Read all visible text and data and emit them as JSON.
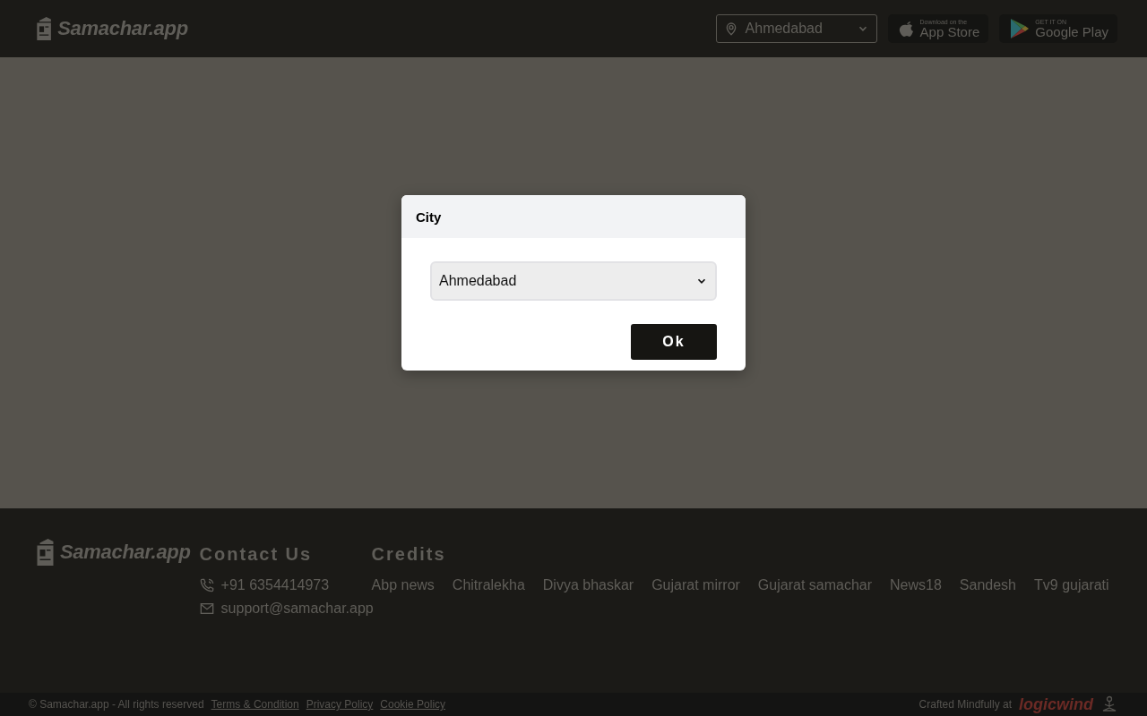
{
  "header": {
    "logo": "Samachar.app",
    "city_select": {
      "value": "Ahmedabad"
    },
    "store_badges": [
      {
        "kind": "apple",
        "small": "Download on the",
        "large": "App Store"
      },
      {
        "kind": "google",
        "small": "GET IT ON",
        "large": "Google Play"
      }
    ]
  },
  "dialog": {
    "title": "City",
    "select": {
      "value": "Ahmedabad"
    },
    "button": "Ok"
  },
  "footer": {
    "logo": "Samachar.app",
    "contact": {
      "heading": "Contact Us",
      "items": [
        {
          "kind": "phone",
          "text": "+91 6354414973"
        },
        {
          "kind": "email",
          "text": "support@samachar.app"
        }
      ]
    },
    "credits": {
      "heading": "Credits",
      "items": [
        "Abp news",
        "Chitralekha",
        "Divya bhaskar",
        "Gujarat mirror",
        "Gujarat samachar",
        "News18",
        "Sandesh",
        "Tv9 gujarati"
      ]
    }
  },
  "bottom_bar": {
    "copyright": "© Samachar.app - All rights reserved",
    "links": [
      "Terms & Condition",
      "Privacy Policy",
      "Cookie Policy"
    ],
    "crafted": "Crafted Mindfully at",
    "brand": "logicwind"
  }
}
